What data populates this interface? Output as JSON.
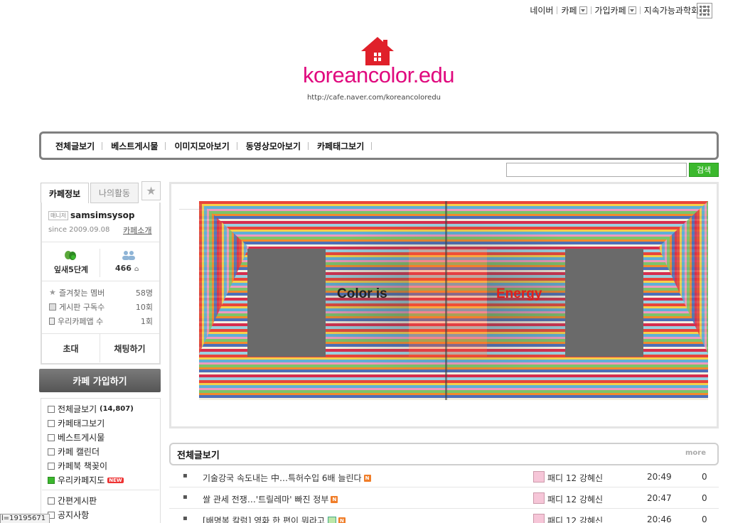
{
  "gnb": {
    "items": [
      "네이버",
      "카페",
      "가입카페",
      "지속가능과학회"
    ],
    "dropdown_after": [
      false,
      true,
      true,
      true
    ]
  },
  "header": {
    "title": "koreancolor.edu",
    "url": "http://cafe.naver.com/koreancoloredu",
    "brand_color": "#e0097e"
  },
  "menubar": {
    "items": [
      "전체글보기",
      "베스트게시물",
      "이미지모아보기",
      "동영상모아보기",
      "카페태그보기"
    ]
  },
  "search": {
    "placeholder": "",
    "button_label": "검색"
  },
  "sidebar": {
    "tabs": [
      "카페정보",
      "나의활동"
    ],
    "manager_badge": "매니저",
    "manager_name": "samsimsysop",
    "since": "since 2009.09.08",
    "intro_link": "카페소개",
    "level": "잎새5단계",
    "member_count": "466",
    "stats": [
      {
        "label": "즐겨찾는 멤버",
        "value": "58명"
      },
      {
        "label": "게시판 구독수",
        "value": "10회"
      },
      {
        "label": "우리카페앱 수",
        "value": "1회"
      }
    ],
    "invite_label": "초대",
    "chat_label": "채팅하기",
    "join_label": "카페 가입하기",
    "menu": [
      {
        "label": "전체글보기",
        "count": "(14,807)"
      },
      {
        "label": "카페태그보기"
      },
      {
        "label": "베스트게시물"
      },
      {
        "label": "카페 캘린더"
      },
      {
        "label": "카페북 책꽂이"
      },
      {
        "label": "우리카페지도",
        "badge": "NEW"
      },
      {
        "label": "간편게시판"
      },
      {
        "label": "공지사항"
      }
    ],
    "status_text": "l=19195671"
  },
  "banner": {
    "text_left": "Color is",
    "text_right": "Energy"
  },
  "board": {
    "title": "전체글보기",
    "more_label": "more",
    "posts": [
      {
        "title": "기술강국 속도내는 中…특허수입 6배 늘린다",
        "author": "패디 12 강혜신",
        "time": "20:49",
        "views": "0",
        "image": false
      },
      {
        "title": "쌀 관세 전쟁…'트릴레마' 빠진 정부",
        "author": "패디 12 강혜신",
        "time": "20:47",
        "views": "0",
        "image": false
      },
      {
        "title": "[배명복 칼럼] 영화 한 편이 뭐라고",
        "author": "패디 12 강혜신",
        "time": "20:46",
        "views": "0",
        "image": true
      }
    ]
  }
}
